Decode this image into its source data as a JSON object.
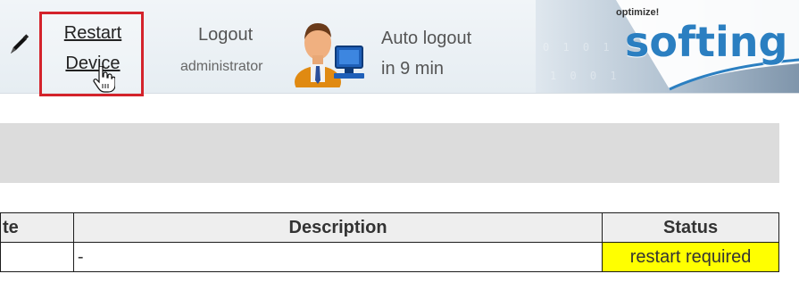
{
  "header": {
    "restart_line1": "Restart",
    "restart_line2": "Device",
    "logout_label": "Logout",
    "user_name": "administrator",
    "auto_logout_line1": "Auto logout",
    "auto_logout_line2": "in 9 min",
    "brand_tagline": "optimize!",
    "brand_name": "softing"
  },
  "table": {
    "headers": {
      "date": "te",
      "description": "Description",
      "status": "Status"
    },
    "rows": [
      {
        "description": "-",
        "status": "restart required"
      }
    ]
  },
  "colors": {
    "highlight_border": "#d4232b",
    "status_required": "#ffff00",
    "brand_blue": "#2b7fc1",
    "banner_gray": "#dcdcdc"
  },
  "icons": [
    "pencil-icon",
    "hand-cursor-icon",
    "user-at-computer-icon"
  ]
}
